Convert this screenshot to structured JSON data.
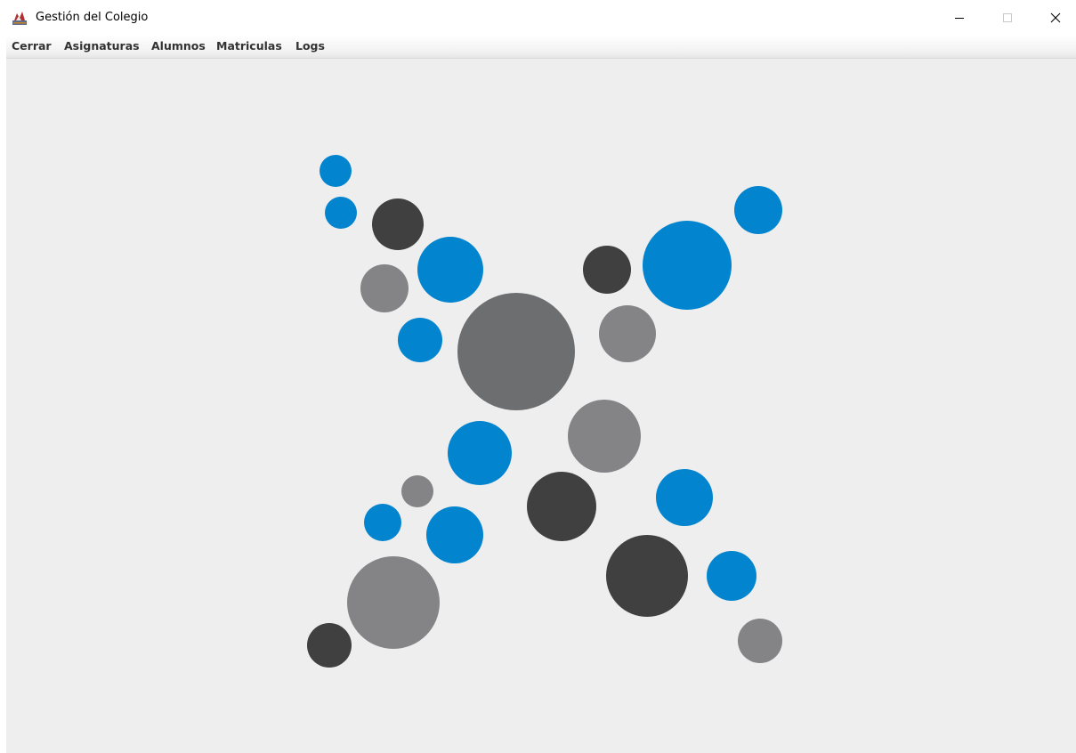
{
  "window": {
    "title": "Gestión del Colegio",
    "icon": "java-cup-icon",
    "controls": [
      "minimize-icon",
      "maximize-icon",
      "close-icon"
    ]
  },
  "menu": {
    "items": [
      {
        "label": "Cerrar"
      },
      {
        "label": "Asignaturas"
      },
      {
        "label": "Alumnos"
      },
      {
        "label": "Matriculas"
      },
      {
        "label": "Logs"
      }
    ]
  },
  "colors": {
    "blue": "#0284cf",
    "dark": "#404040",
    "gray": "#848487",
    "big_gray": "#6d6e70",
    "background": "#eeeeee"
  },
  "logo": {
    "icon": "bubble-x-logo"
  }
}
